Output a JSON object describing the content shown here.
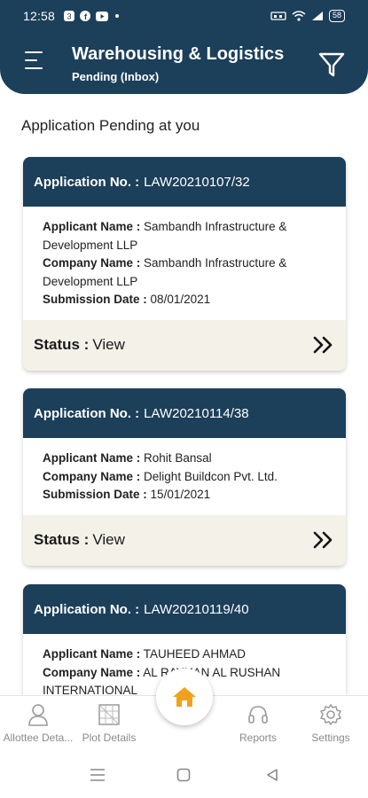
{
  "status_bar": {
    "time": "12:58",
    "battery": "58"
  },
  "header": {
    "title": "Warehousing & Logistics",
    "subtitle": "Pending (Inbox)"
  },
  "section_title": "Application Pending at you",
  "cards": [
    {
      "app_label": "Application No. :",
      "app_no": "LAW20210107/32",
      "rows": [
        {
          "label": "Applicant Name :",
          "value": "Sambandh Infrastructure & Development LLP"
        },
        {
          "label": "Company Name :",
          "value": "Sambandh Infrastructure & Development LLP"
        },
        {
          "label": "Submission Date :",
          "value": "08/01/2021"
        }
      ],
      "status_label": "Status :",
      "status_value": "View"
    },
    {
      "app_label": "Application No. :",
      "app_no": "LAW20210114/38",
      "rows": [
        {
          "label": "Applicant Name :",
          "value": "Rohit Bansal"
        },
        {
          "label": "Company Name :",
          "value": "Delight Buildcon Pvt. Ltd."
        },
        {
          "label": "Submission Date :",
          "value": "15/01/2021"
        }
      ],
      "status_label": "Status :",
      "status_value": "View"
    },
    {
      "app_label": "Application No. :",
      "app_no": "LAW20210119/40",
      "rows": [
        {
          "label": "Applicant Name :",
          "value": "TAUHEED AHMAD"
        },
        {
          "label": "Company Name :",
          "value": "AL RAYHAN AL RUSHAN INTERNATIONAL"
        }
      ]
    }
  ],
  "bottom_nav": {
    "allottee": "Allottee Deta...",
    "plot": "Plot Details",
    "reports": "Reports",
    "settings": "Settings"
  },
  "colors": {
    "primary": "#1c3f5a",
    "accent": "#f0a21b",
    "footer_bg": "#f3f1e8"
  }
}
